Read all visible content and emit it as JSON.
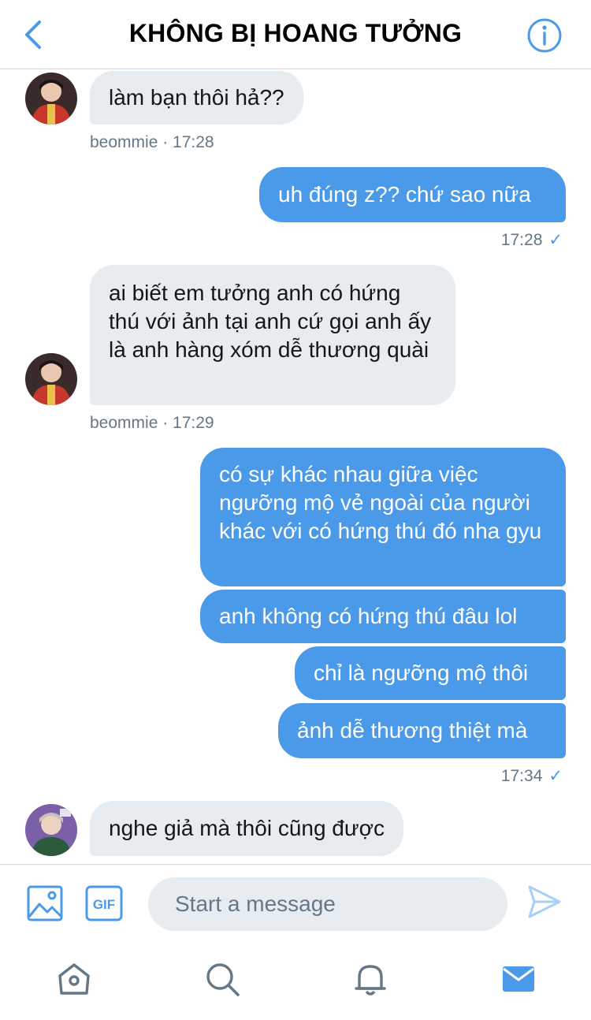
{
  "header": {
    "title": "KHÔNG BỊ HOANG TƯỞNG"
  },
  "messages": [
    {
      "side": "in",
      "text": "làm bạn thôi hả??",
      "meta": "beommie · 17:28"
    },
    {
      "side": "out",
      "text": "uh đúng z?? chứ sao nữa",
      "meta": "17:28"
    },
    {
      "side": "in",
      "text": "ai biết em tưởng anh có hứng thú với ảnh tại anh cứ gọi anh ấy là anh hàng xóm dễ thương quài",
      "meta": "beommie · 17:29"
    },
    {
      "side": "out",
      "text": "có sự khác nhau giữa việc ngưỡng mộ vẻ ngoài của người khác với có hứng thú đó nha gyu"
    },
    {
      "side": "out",
      "text": "anh không có hứng thú đâu lol"
    },
    {
      "side": "out",
      "text": "chỉ là ngưỡng mộ thôi"
    },
    {
      "side": "out",
      "text": "ảnh dễ thương thiệt mà",
      "meta": "17:34"
    },
    {
      "side": "in",
      "text": "nghe giả mà thôi cũng được"
    }
  ],
  "read_receipt_icon": "checkmark-icon",
  "composer": {
    "placeholder": "Start a message",
    "gif_label": "GIF",
    "icons": [
      "image-icon",
      "gif-icon",
      "send-icon"
    ]
  },
  "tabbar": {
    "items": [
      "home-icon",
      "search-icon",
      "notifications-icon",
      "messages-icon"
    ],
    "active": "messages-icon"
  },
  "colors": {
    "accent": "#4b99e9",
    "incoming_bubble": "#e6ecf0",
    "meta_text": "#657786"
  }
}
